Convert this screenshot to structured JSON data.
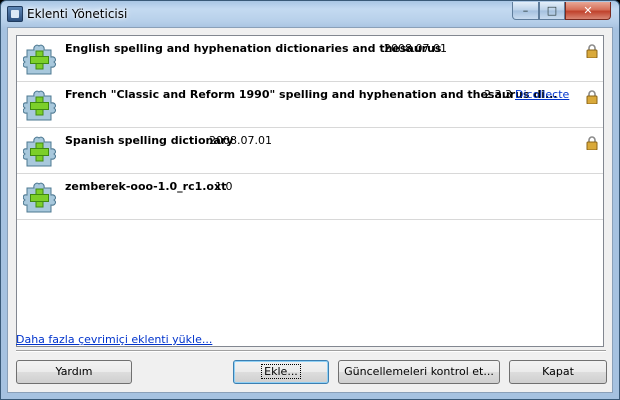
{
  "window": {
    "title": "Eklenti Yöneticisi",
    "minimize_glyph": "–",
    "maximize_glyph": "□",
    "close_glyph": "✕"
  },
  "extensions": [
    {
      "name": "English spelling and hyphenation dictionaries and thesaurus",
      "version": "2008.07.01",
      "link": "",
      "locked": true,
      "icon": "puzzle-piece-add-icon"
    },
    {
      "name": "French \"Classic and Reform 1990\" spelling and hyphenation and thesaurus di...",
      "version": "2.3.3",
      "link": "Dicollecte",
      "locked": true,
      "icon": "puzzle-piece-add-icon"
    },
    {
      "name": "Spanish spelling dictionary",
      "version": "2008.07.01",
      "link": "",
      "locked": true,
      "icon": "puzzle-piece-add-icon"
    },
    {
      "name": "zemberek-ooo-1.0_rc1.oxt",
      "version": "1.0",
      "link": "",
      "locked": false,
      "icon": "puzzle-piece-add-icon"
    }
  ],
  "more_extensions_link": "Daha fazla çevrimiçi eklenti yükle...",
  "buttons": {
    "help": "Yardım",
    "add": "Ekle...",
    "check_updates": "Güncellemeleri kontrol et...",
    "close": "Kapat"
  },
  "colors": {
    "link": "#0033cc",
    "puzzle_fill": "#a8c8dc",
    "plus_fill": "#7ccf2a",
    "lock_fill": "#d9a93a"
  }
}
